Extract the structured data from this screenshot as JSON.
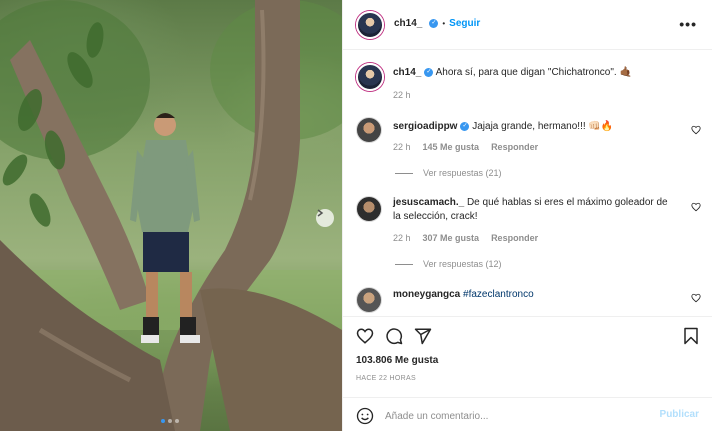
{
  "post": {
    "author": "ch14_",
    "follow_label": "Seguir",
    "separator": "•",
    "more_label": "•••"
  },
  "caption": {
    "username": "ch14_",
    "text": "Ahora sí, para que digan \"Chichatronco\". 🤙🏾",
    "time": "22 h"
  },
  "comments": [
    {
      "username": "sergioadippw",
      "text": "Jajaja grande, hermano!!! 👊🏻🔥",
      "time": "22 h",
      "likes": "145 Me gusta",
      "reply_label": "Responder",
      "view_replies": "Ver respuestas (21)"
    },
    {
      "username": "jesuscamach._",
      "text": "De qué hablas si eres el máximo goleador de la selección, crack!",
      "time": "22 h",
      "likes": "307 Me gusta",
      "reply_label": "Responder",
      "view_replies": "Ver respuestas (12)"
    },
    {
      "username": "moneygangca",
      "hashtag": "#fazeclantronco"
    }
  ],
  "actions": {
    "likes": "103.806 Me gusta",
    "time_ago": "HACE 22 HORAS"
  },
  "comment_box": {
    "placeholder": "Añade un comentario...",
    "publish_label": "Publicar"
  },
  "colors": {
    "link_blue": "#0095f6",
    "verified_blue": "#3897f0",
    "muted": "#8e8e8e"
  }
}
